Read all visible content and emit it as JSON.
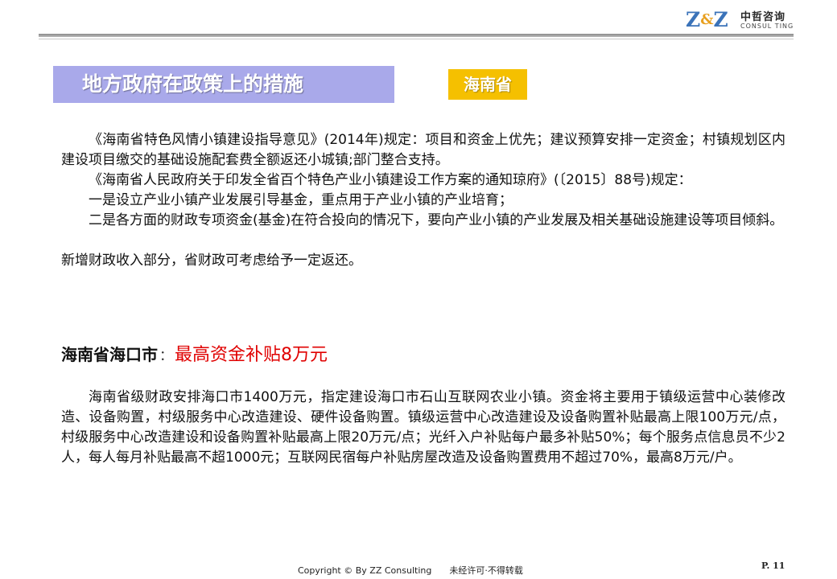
{
  "header": {
    "logo": {
      "mark_left": "Z",
      "mark_amp": "&",
      "mark_right": "Z",
      "name_cn": "中哲咨询",
      "name_en": "CONSUL TING"
    },
    "accent_color": "#3b73b9"
  },
  "slide": {
    "title": "地方政府在政策上的措施",
    "title_bg": "#a9a9ea",
    "province_tag": "海南省",
    "tag_bg": "#f5c000"
  },
  "section1": {
    "paragraphs": [
      "《海南省特色风情小镇建设指导意见》(2014年)规定：项目和资金上优先；建议预算安排一定资金；村镇规划区内建设项目缴交的基础设施配套费全额返还小城镇;部门整合支持。",
      "《海南省人民政府关于印发全省百个特色产业小镇建设工作方案的通知琼府》(〔2015〕88号)规定：",
      "一是设立产业小镇产业发展引导基金，重点用于产业小镇的产业培育；",
      "二是各方面的财政专项资金(基金)在符合投向的情况下，要向产业小镇的产业发展及相关基础设施建设等项目倾斜。"
    ],
    "closing": "新增财政收入部分，省财政可考虑给予一定返还。"
  },
  "section2": {
    "heading_name": "海南省海口市",
    "heading_colon": "：",
    "heading_highlight": "最高资金补贴8万元",
    "highlight_color": "#e00000",
    "paragraph": "海南省级财政安排海口市1400万元，指定建设海口市石山互联网农业小镇。资金将主要用于镇级运营中心装修改造、设备购置，村级服务中心改造建设、硬件设备购置。镇级运营中心改造建设及设备购置补贴最高上限100万元/点，村级服务中心改造建设和设备购置补贴最高上限20万元/点；光纤入户补贴每户最多补贴50%；每个服务点信息员不少2人，每人每月补贴最高不超1000元；互联网民宿每户补贴房屋改造及设备购置费用不超过70%，最高8万元/户。"
  },
  "footer": {
    "copyright": "Copyright © By  ZZ Consulting",
    "notice": "未经许可·不得转载",
    "page": "P. 11"
  }
}
